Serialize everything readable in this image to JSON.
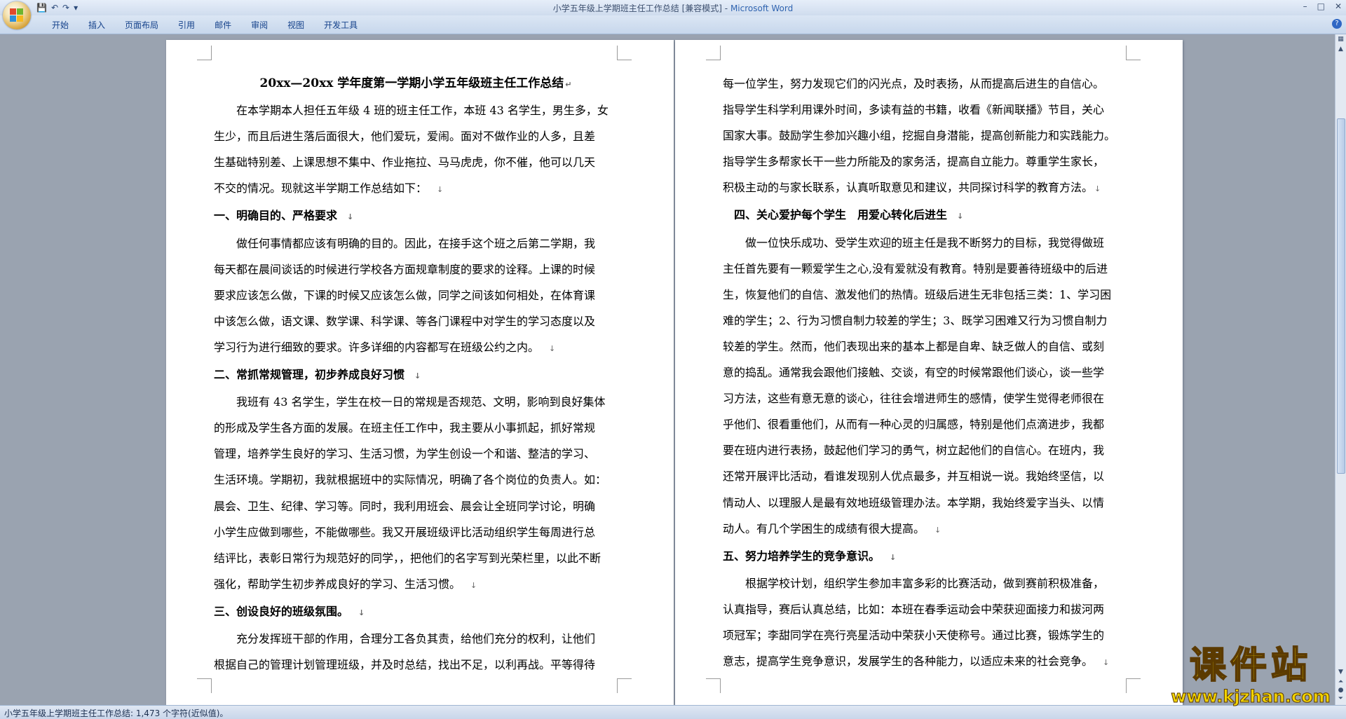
{
  "window": {
    "title_doc": "小学五年级上学期班主任工作总结 [兼容模式]",
    "title_sep": " - ",
    "title_app": "Microsoft Word",
    "minimize": "–",
    "maximize": "□",
    "close": "✕"
  },
  "qat": {
    "save": "💾",
    "undo": "↶",
    "redo": "↷",
    "more": "▾"
  },
  "ribbon_tabs": [
    "开始",
    "插入",
    "页面布局",
    "引用",
    "邮件",
    "审阅",
    "视图",
    "开发工具"
  ],
  "help": "?",
  "status": {
    "text": "小学五年级上学期班主任工作总结: 1,473 个字符(近似值)。"
  },
  "watermark": {
    "brand": "课件站",
    "url": "www.kjzhan.com"
  },
  "para_mark": "↓",
  "page1": {
    "title": "20xx—20xx 学年度第一学期小学五年级班主任工作总结",
    "title_mark": "↵",
    "lines": [
      "在本学期本人担任五年级 4 班的班主任工作，本班 43 名学生，男生多，女",
      "生少，而且后进生落后面很大，他们爱玩，爱闹。面对不做作业的人多，且差",
      "生基础特别差、上课思想不集中、作业拖拉、马马虎虎，你不催，他可以几天",
      "不交的情况。现就这半学期工作总结如下：",
      "一、明确目的、严格要求",
      "做任何事情都应该有明确的目的。因此，在接手这个班之后第二学期，我",
      "每天都在晨间谈话的时候进行学校各方面规章制度的要求的诠释。上课的时候",
      "要求应该怎么做，下课的时候又应该怎么做，同学之间该如何相处，在体育课",
      "中该怎么做，语文课、数学课、科学课、等各门课程中对学生的学习态度以及",
      "学习行为进行细致的要求。许多详细的内容都写在班级公约之内。",
      "二、常抓常规管理，初步养成良好习惯",
      "我班有 43 名学生，学生在校一日的常规是否规范、文明，影响到良好集体",
      "的形成及学生各方面的发展。在班主任工作中，我主要从小事抓起，抓好常规",
      "管理，培养学生良好的学习、生活习惯，为学生创设一个和谐、整洁的学习、",
      "生活环境。学期初，我就根据班中的实际情况，明确了各个岗位的负责人。如：",
      "晨会、卫生、纪律、学习等。同时，我利用班会、晨会让全班同学讨论，明确",
      "小学生应做到哪些，不能做哪些。我又开展班级评比活动组织学生每周进行总",
      "结评比，表彰日常行为规范好的同学，，把他们的名字写到光荣栏里，以此不断",
      "强化，帮助学生初步养成良好的学习、生活习惯。",
      "三、创设良好的班级氛围。",
      "充分发挥班干部的作用，合理分工各负其责，给他们充分的权利，让他们",
      "根据自己的管理计划管理班级，并及时总结，找出不足，以利再战。平等得待"
    ]
  },
  "page2": {
    "lines": [
      "每一位学生，努力发现它们的闪光点，及时表扬，从而提高后进生的自信心。",
      "指导学生科学利用课外时间，多读有益的书籍，收看《新闻联播》节目，关心",
      "国家大事。鼓励学生参加兴趣小组，挖掘自身潜能，提高创新能力和实践能力。",
      "指导学生多帮家长干一些力所能及的家务活，提高自立能力。尊重学生家长，",
      "积极主动的与家长联系，认真听取意见和建议，共同探讨科学的教育方法。",
      "四、关心爱护每个学生　用爱心转化后进生",
      "做一位快乐成功、受学生欢迎的班主任是我不断努力的目标，我觉得做班",
      "主任首先要有一颗爱学生之心,没有爱就没有教育。特别是要善待班级中的后进",
      "生，恢复他们的自信、激发他们的热情。班级后进生无非包括三类：1、学习困",
      "难的学生；2、行为习惯自制力较差的学生；3、既学习困难又行为习惯自制力",
      "较差的学生。然而，他们表现出来的基本上都是自卑、缺乏做人的自信、或刻",
      "意的捣乱。通常我会跟他们接触、交谈，有空的时候常跟他们谈心，谈一些学",
      "习方法，这些有意无意的谈心，往往会增进师生的感情，使学生觉得老师很在",
      "乎他们、很看重他们，从而有一种心灵的归属感，特别是他们点滴进步，我都",
      "要在班内进行表扬，鼓起他们学习的勇气，树立起他们的自信心。在班内，我",
      "还常开展评比活动，看谁发现别人优点最多，并互相说一说。我始终坚信，以",
      "情动人、以理服人是最有效地班级管理办法。本学期，我始终爱字当头、以情",
      "动人。有几个学困生的成绩有很大提高。",
      "五、努力培养学生的竞争意识。",
      "根据学校计划，组织学生参加丰富多彩的比赛活动，做到赛前积极准备，",
      "认真指导，赛后认真总结，比如：本班在春季运动会中荣获迎面接力和拔河两",
      "项冠军；李甜同学在亮行亮星活动中荣获小天使称号。通过比赛，锻炼学生的",
      "意志，提高学生竞争意识，发展学生的各种能力，以适应未来的社会竞争。"
    ]
  }
}
